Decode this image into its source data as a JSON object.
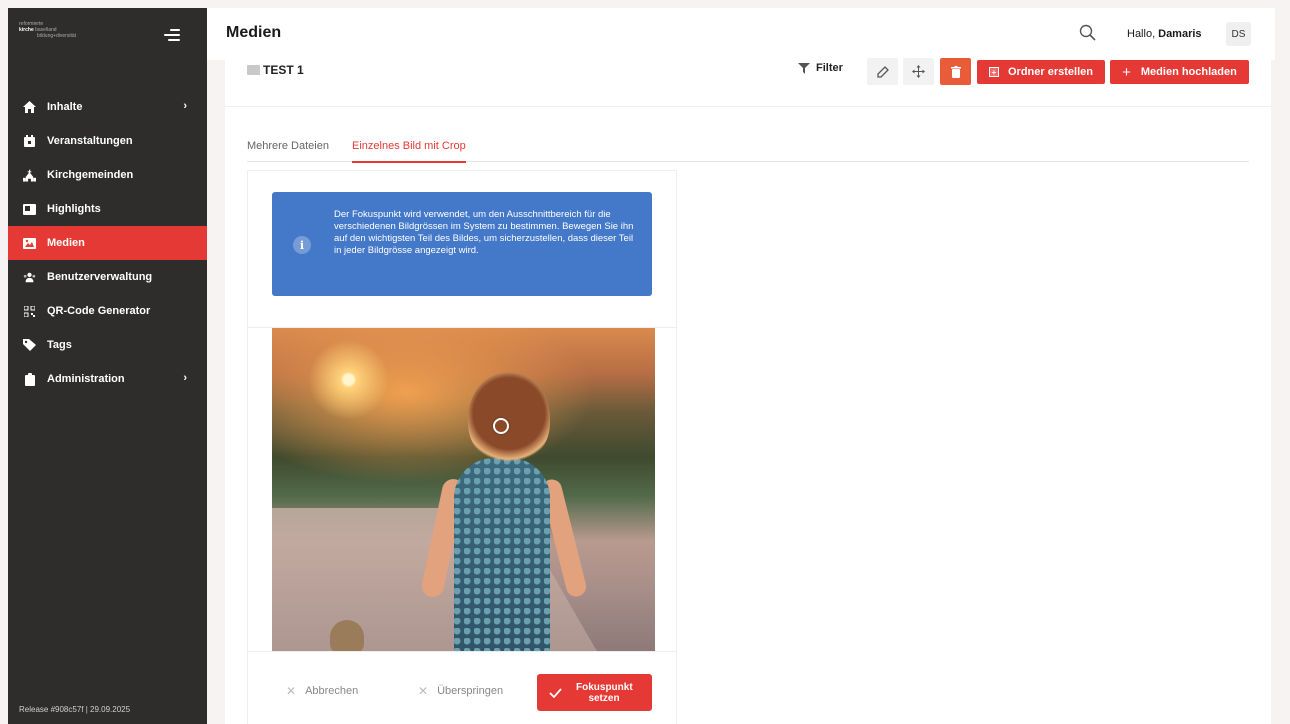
{
  "sidebar": {
    "logo": {
      "line1": "reformierte",
      "line2_bold": "kirche",
      "line2": "baselland",
      "line3": "bildung+diversität"
    },
    "items": [
      {
        "label": "Inhalte",
        "icon": "home-icon",
        "has_children": true
      },
      {
        "label": "Veranstaltungen",
        "icon": "calendar-icon",
        "has_children": false
      },
      {
        "label": "Kirchgemeinden",
        "icon": "church-icon",
        "has_children": false
      },
      {
        "label": "Highlights",
        "icon": "highlight-icon",
        "has_children": false
      },
      {
        "label": "Medien",
        "icon": "image-icon",
        "has_children": false,
        "active": true
      },
      {
        "label": "Benutzerverwaltung",
        "icon": "users-icon",
        "has_children": false
      },
      {
        "label": "QR-Code Generator",
        "icon": "qr-code-icon",
        "has_children": false
      },
      {
        "label": "Tags",
        "icon": "tag-icon",
        "has_children": false
      },
      {
        "label": "Administration",
        "icon": "clipboard-icon",
        "has_children": true
      }
    ],
    "chevron": "›",
    "release": "Release #908c57f | 29.09.2025"
  },
  "header": {
    "title": "Medien",
    "greeting": "Hallo,",
    "user_name": "Damaris",
    "avatar_initials": "DS"
  },
  "toolbar": {
    "folder_name": "TEST 1",
    "filter_label": "Filter",
    "create_folder_label": "Ordner erstellen",
    "upload_label": "Medien hochladen"
  },
  "tabs": [
    {
      "label": "Mehrere Dateien",
      "active": false
    },
    {
      "label": "Einzelnes Bild mit Crop",
      "active": true
    }
  ],
  "info": {
    "text": "Der Fokuspunkt wird verwendet, um den Ausschnittbereich für die verschiedenen Bildgrössen im System zu bestimmen. Bewegen Sie ihn auf den wichtigsten Teil des Bildes, um sicherzustellen, dass dieser Teil in jeder Bildgrösse angezeigt wird."
  },
  "footer": {
    "cancel_label": "Abbrechen",
    "skip_label": "Überspringen",
    "confirm_line1": "Fokuspunkt",
    "confirm_line2": "setzen"
  },
  "colors": {
    "accent": "#e53935",
    "sidebar_bg": "#2e2d2c",
    "info_bg": "#4478c8"
  }
}
